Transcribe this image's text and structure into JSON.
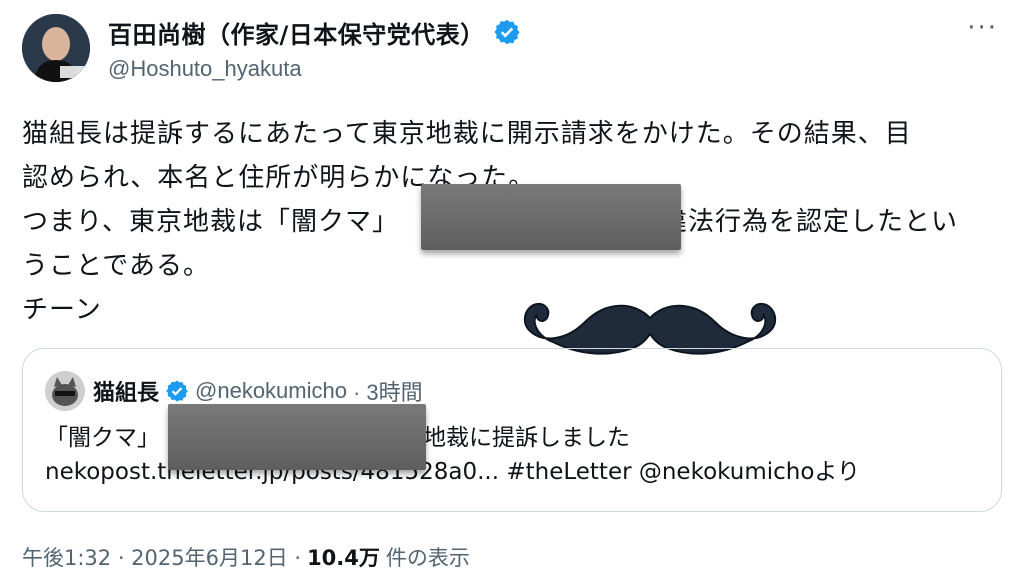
{
  "author": {
    "display_name": "百田尚樹（作家/日本保守党代表）",
    "handle": "@Hoshuto_hyakuta",
    "verified": true,
    "avatar_icon": "profile-photo"
  },
  "more_menu": "···",
  "body": {
    "line1": "猫組長は提訴するにあたって東京地裁に開示請求をかけた。その結果、目",
    "line2": "認められ、本名と住所が明らかになった。",
    "line3_a": "つまり、東京地裁は「闇クマ」",
    "line3_b": "違法行為を認定したとい",
    "line4": "うことである。",
    "line5": "チーン"
  },
  "quote": {
    "name": "猫組長",
    "handle": "@nekokumicho",
    "time": "· 3時間",
    "text_a": "「闇クマ」",
    "text_b": "京地裁に提訴しました",
    "link_line": "nekopost.theletter.jp/posts/481528a0... #theLetter @nekokumichoより"
  },
  "footer": {
    "time": "午後1:32 · 2025年6月12日 ·",
    "views": "10.4万",
    "views_suffix": "件の表示"
  },
  "colors": {
    "verified_blue": "#1d9bf0",
    "secondary_text": "#536471",
    "border": "#cfd9de",
    "mustache": "#1f2b3a"
  }
}
